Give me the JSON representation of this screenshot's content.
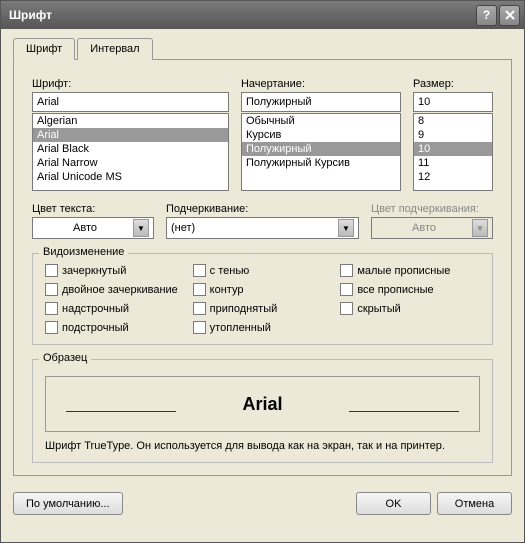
{
  "title": "Шрифт",
  "tabs": {
    "font": "Шрифт",
    "interval": "Интервал"
  },
  "labels": {
    "font": "Шрифт:",
    "style": "Начертание:",
    "size": "Размер:",
    "textcolor": "Цвет текста:",
    "underline": "Подчеркивание:",
    "ulcolor": "Цвет подчеркивания:",
    "effects": "Видоизменение",
    "sample": "Образец"
  },
  "font": {
    "value": "Arial",
    "items": [
      "Algerian",
      "Arial",
      "Arial Black",
      "Arial Narrow",
      "Arial Unicode MS"
    ],
    "selected": "Arial"
  },
  "style": {
    "value": "Полужирный",
    "items": [
      "Обычный",
      "Курсив",
      "Полужирный",
      "Полужирный Курсив"
    ],
    "selected": "Полужирный"
  },
  "size": {
    "value": "10",
    "items": [
      "8",
      "9",
      "10",
      "11",
      "12"
    ],
    "selected": "10"
  },
  "textcolor": "Авто",
  "underline": "(нет)",
  "ulcolor": "Авто",
  "effects": {
    "strike": "зачеркнутый",
    "dstrike": "двойное зачеркивание",
    "super": "надстрочный",
    "sub": "подстрочный",
    "shadow": "с тенью",
    "outline": "контур",
    "emboss": "приподнятый",
    "engrave": "утопленный",
    "smallcaps": "малые прописные",
    "allcaps": "все прописные",
    "hidden": "скрытый"
  },
  "sample_text": "Arial",
  "note": "Шрифт TrueType. Он используется для вывода как на экран, так и на принтер.",
  "buttons": {
    "default": "По умолчанию...",
    "ok": "OK",
    "cancel": "Отмена"
  }
}
